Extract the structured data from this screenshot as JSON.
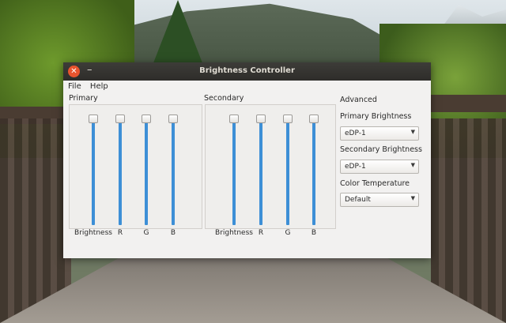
{
  "window": {
    "title": "Brightness Controller",
    "close_glyph": "✕",
    "minimize_glyph": "–"
  },
  "menu": {
    "items": [
      {
        "label": "File"
      },
      {
        "label": "Help"
      }
    ]
  },
  "primary": {
    "label": "Primary",
    "sliders": [
      {
        "label": "Brightness",
        "value_percent": 100
      },
      {
        "label": "R",
        "value_percent": 100
      },
      {
        "label": "G",
        "value_percent": 100
      },
      {
        "label": "B",
        "value_percent": 100
      }
    ]
  },
  "secondary": {
    "label": "Secondary",
    "sliders": [
      {
        "label": "Brightness",
        "value_percent": 100
      },
      {
        "label": "R",
        "value_percent": 100
      },
      {
        "label": "G",
        "value_percent": 100
      },
      {
        "label": "B",
        "value_percent": 100
      }
    ]
  },
  "advanced": {
    "heading": "Advanced",
    "primary_brightness": {
      "label": "Primary Brightness",
      "selected": "eDP-1"
    },
    "secondary_brightness": {
      "label": "Secondary Brightness",
      "selected": "eDP-1"
    },
    "color_temperature": {
      "label": "Color Temperature",
      "selected": "Default"
    }
  },
  "icons": {
    "close": "close-icon",
    "minimize": "minimize-icon",
    "dropdown": "chevron-down-icon"
  },
  "colors": {
    "slider_fill": "#3d8fd6",
    "close_button": "#e8542e",
    "titlebar": "#3d3c38"
  }
}
